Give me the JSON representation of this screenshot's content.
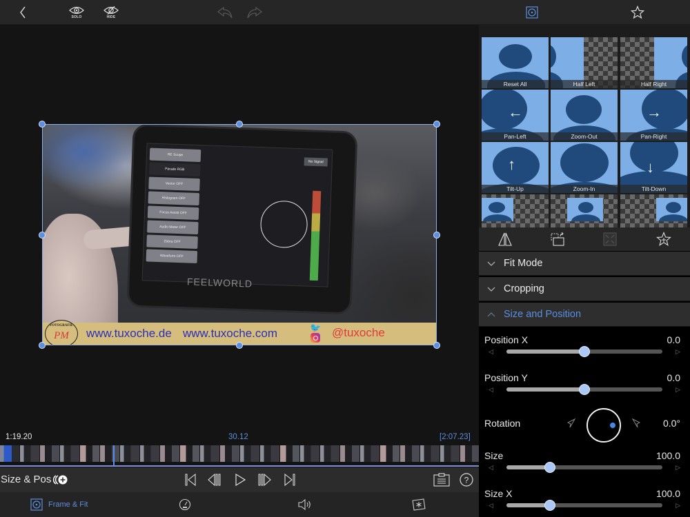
{
  "toolbar": {
    "back_icon": "chevron-left-icon",
    "solo_label": "SOLO",
    "hide_label": "HIDE",
    "undo_icon": "undo-icon",
    "redo_icon": "redo-icon",
    "frame_fit_icon": "frame-fit-icon",
    "favorites_icon": "star-icon"
  },
  "video": {
    "monitor_brand": "FEELWORLD",
    "no_signal": "No Signal",
    "monitor_menu": [
      "RE Scope",
      "Parade RGB",
      "Vector OFF",
      "Histogram OFF",
      "Focus Assist OFF",
      "Audio Meter OFF",
      "Zebra OFF",
      "Waveform OFF"
    ],
    "banner": {
      "logo_top": "FOTOGRAFIE",
      "logo_initials": "PM",
      "url1": "www.tuxoche.de",
      "url2": "www.tuxoche.com",
      "handle": "@tuxoche"
    }
  },
  "timeline": {
    "current_time": "1:19.20",
    "clip_duration": "30.12",
    "total_time": "[2:07.23]",
    "accent_color": "#5a8ff0"
  },
  "transport": {
    "effect_label": "Size & Pos",
    "keyframe_icon": "add-keyframe-icon",
    "buttons": [
      "skip-to-start",
      "step-back",
      "play",
      "step-forward",
      "skip-to-end"
    ],
    "clipboard_icon": "clipboard-icon",
    "help_icon": "help-icon"
  },
  "tabs": [
    {
      "label": "Frame & Fit",
      "icon": "frame-fit-icon",
      "active": true
    },
    {
      "label": "",
      "icon": "speed-icon",
      "active": false
    },
    {
      "label": "",
      "icon": "audio-icon",
      "active": false
    },
    {
      "label": "",
      "icon": "effects-icon",
      "active": false
    }
  ],
  "presets": [
    {
      "label": "Reset All"
    },
    {
      "label": "Half Left"
    },
    {
      "label": "Half Right"
    },
    {
      "label": "Pan-Left"
    },
    {
      "label": "Zoom-Out"
    },
    {
      "label": "Pan-Right"
    },
    {
      "label": "Tilt-Up"
    },
    {
      "label": "Zoom-In"
    },
    {
      "label": "Tilt-Down"
    }
  ],
  "preset_bar": {
    "flip_icon": "flip-icon",
    "rotate_frame_icon": "rotate-frame-icon",
    "fit_icon": "fit-icon",
    "add_favorite_icon": "add-favorite-icon"
  },
  "sections": [
    {
      "label": "Fit Mode",
      "open": false
    },
    {
      "label": "Cropping",
      "open": false
    },
    {
      "label": "Size and Position",
      "open": true
    }
  ],
  "properties": {
    "position_x": {
      "label": "Position X",
      "value": "0.0",
      "fraction": 0.5
    },
    "position_y": {
      "label": "Position Y",
      "value": "0.0",
      "fraction": 0.5
    },
    "rotation": {
      "label": "Rotation",
      "value": "0.0°"
    },
    "size": {
      "label": "Size",
      "value": "100.0",
      "fraction": 0.28
    },
    "size_x": {
      "label": "Size X",
      "value": "100.0",
      "fraction": 0.28
    }
  },
  "colors": {
    "accent": "#5c8fe0",
    "preset_bg": "#7eaee6",
    "preset_figure": "#204a7c"
  }
}
